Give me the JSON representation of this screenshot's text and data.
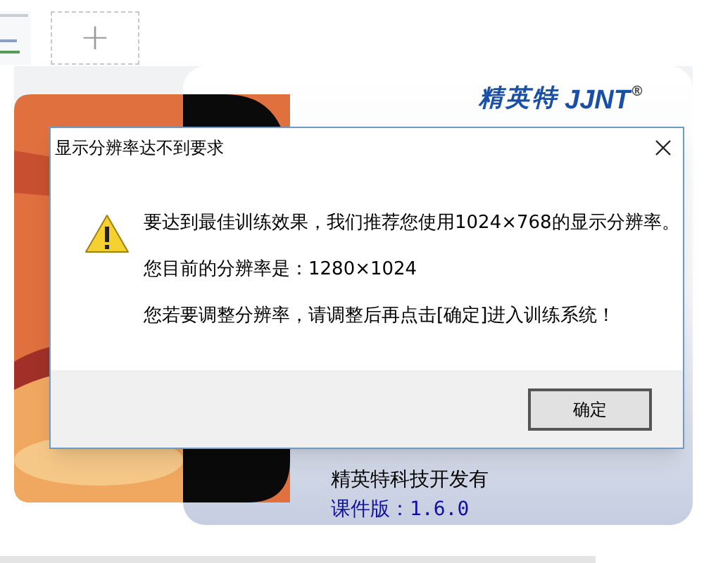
{
  "page": {
    "add_tile": {
      "label": "+"
    }
  },
  "splash": {
    "logo": {
      "chinese": "精英特",
      "latin": "JJNT",
      "mark": "®"
    },
    "company": "精英特科技开发有",
    "version": "课件版：1.6.0"
  },
  "dialog": {
    "title": "显示分辨率达不到要求",
    "messages": [
      "要达到最佳训练效果，我们推荐您使用1024×768的显示分辨率。",
      "您目前的分辨率是：1280×1024",
      "您若要调整分辨率，请调整后再点击[确定]进入训练系统！"
    ],
    "buttons": [
      {
        "label": "确定"
      }
    ]
  }
}
